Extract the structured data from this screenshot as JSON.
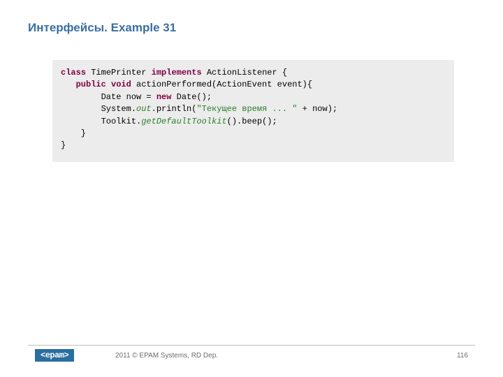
{
  "title": "Интерфейсы. Example 31",
  "code": {
    "kw_class": "class",
    "class_decl": " TimePrinter ",
    "kw_implements": "implements",
    "impl_decl": " ActionListener {",
    "kw_public_void": "public void",
    "method_decl": " actionPerformed(ActionEvent event){",
    "line3a": "        Date now = ",
    "kw_new": "new",
    "line3b": " Date();",
    "line4a": "        System.",
    "it_out": "out",
    "line4b": ".println(",
    "str_lit": "\"Текущее время ... \"",
    "line4c": " + now);",
    "line5a": "        Toolkit.",
    "it_gdt": "getDefaultToolkit",
    "line5b": "().beep();",
    "line6": "    }",
    "line7": "}"
  },
  "footer": {
    "logo": "<epam>",
    "text": "2011 © EPAM Systems, RD Dep.",
    "page": "116"
  }
}
